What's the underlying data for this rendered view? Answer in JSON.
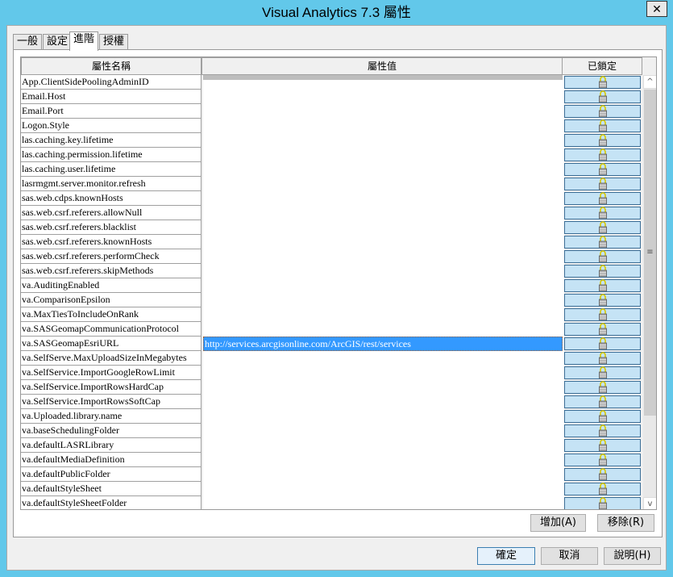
{
  "window": {
    "title": "Visual Analytics 7.3 屬性",
    "close": "✕"
  },
  "tabs": [
    "一般",
    "設定",
    "進階",
    "授權"
  ],
  "active_tab": 2,
  "table": {
    "headers": [
      "屬性名稱",
      "屬性值",
      "已鎖定"
    ],
    "rows": [
      "App.ClientSidePoolingAdminID",
      "Email.Host",
      "Email.Port",
      "Logon.Style",
      "las.caching.key.lifetime",
      "las.caching.permission.lifetime",
      "las.caching.user.lifetime",
      "lasrmgmt.server.monitor.refresh",
      "sas.web.cdps.knownHosts",
      "sas.web.csrf.referers.allowNull",
      "sas.web.csrf.referers.blacklist",
      "sas.web.csrf.referers.knownHosts",
      "sas.web.csrf.referers.performCheck",
      "sas.web.csrf.referers.skipMethods",
      "va.AuditingEnabled",
      "va.ComparisonEpsilon",
      "va.MaxTiesToIncludeOnRank",
      "va.SASGeomapCommunicationProtocol",
      "va.SASGeomapEsriURL",
      "va.SelfServe.MaxUploadSizeInMegabytes",
      "va.SelfService.ImportGoogleRowLimit",
      "va.SelfService.ImportRowsHardCap",
      "va.SelfService.ImportRowsSoftCap",
      "va.Uploaded.library.name",
      "va.baseSchedulingFolder",
      "va.defaultLASRLibrary",
      "va.defaultMediaDefinition",
      "va.defaultPublicFolder",
      "va.defaultStyleSheet",
      "va.defaultStyleSheetFolder"
    ],
    "selected_index": 18,
    "selected_value": "http://services.arcgisonline.com/ArcGIS/rest/services"
  },
  "panel_buttons": {
    "add": "增加(A)",
    "remove": "移除(R)"
  },
  "dialog_buttons": {
    "ok": "確定",
    "cancel": "取消",
    "help": "說明(H)"
  },
  "scrollbar": {
    "up": "^",
    "down": "v",
    "grip": "≡"
  }
}
